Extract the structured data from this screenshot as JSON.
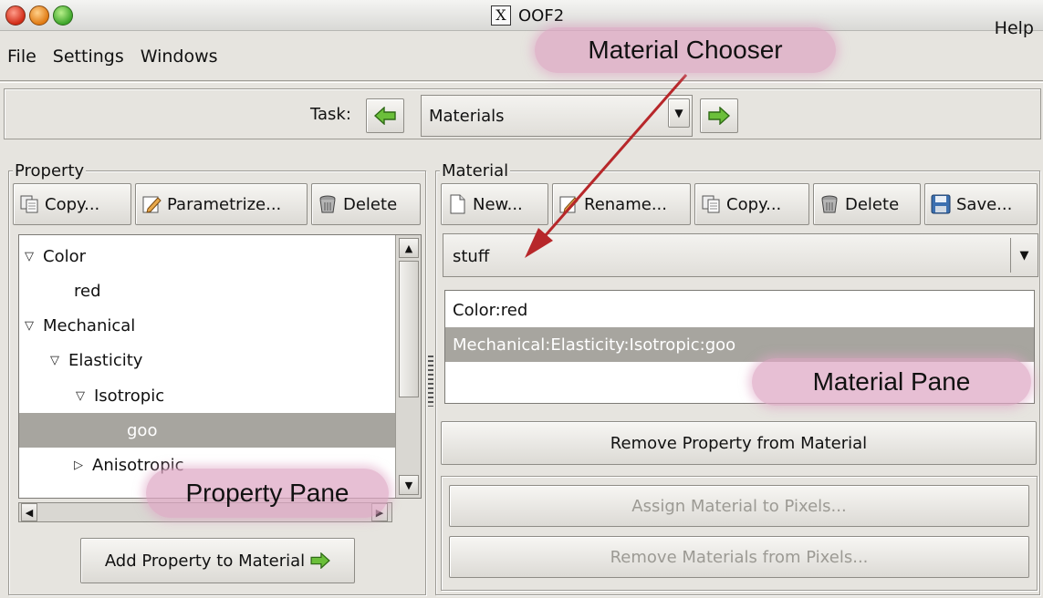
{
  "window": {
    "title": "OOF2"
  },
  "menubar": {
    "items": [
      "File",
      "Settings",
      "Windows"
    ],
    "help": "Help"
  },
  "task": {
    "label": "Task:",
    "selected": "Materials"
  },
  "property_frame": {
    "label": "Property",
    "buttons": {
      "copy": "Copy...",
      "parametrize": "Parametrize...",
      "delete": "Delete"
    },
    "tree": [
      {
        "label": "Color",
        "expander": "▽",
        "depth": 0,
        "selected": false
      },
      {
        "label": "red",
        "expander": "",
        "depth": 1,
        "selected": false
      },
      {
        "label": "Mechanical",
        "expander": "▽",
        "depth": 0,
        "selected": false
      },
      {
        "label": "Elasticity",
        "expander": "▽",
        "depth": 1,
        "selected": false
      },
      {
        "label": "Isotropic",
        "expander": "▽",
        "depth": 2,
        "selected": false
      },
      {
        "label": "goo",
        "expander": "",
        "depth": 3,
        "selected": true
      },
      {
        "label": "Anisotropic",
        "expander": "▷",
        "depth": 2,
        "selected": false
      }
    ],
    "add_button": "Add Property to Material"
  },
  "material_frame": {
    "label": "Material",
    "buttons": {
      "new": "New...",
      "rename": "Rename...",
      "copy": "Copy...",
      "delete": "Delete",
      "save": "Save..."
    },
    "selected_material": "stuff",
    "properties": [
      {
        "label": "Color:red",
        "selected": false
      },
      {
        "label": "Mechanical:Elasticity:Isotropic:goo",
        "selected": true
      }
    ],
    "remove_property_button": "Remove Property from Material",
    "assign_button": "Assign Material to Pixels...",
    "remove_materials_button": "Remove Materials from Pixels..."
  },
  "annotations": {
    "material_chooser": "Material Chooser",
    "material_pane": "Material Pane",
    "property_pane": "Property Pane",
    "color": "#dea6c4"
  }
}
